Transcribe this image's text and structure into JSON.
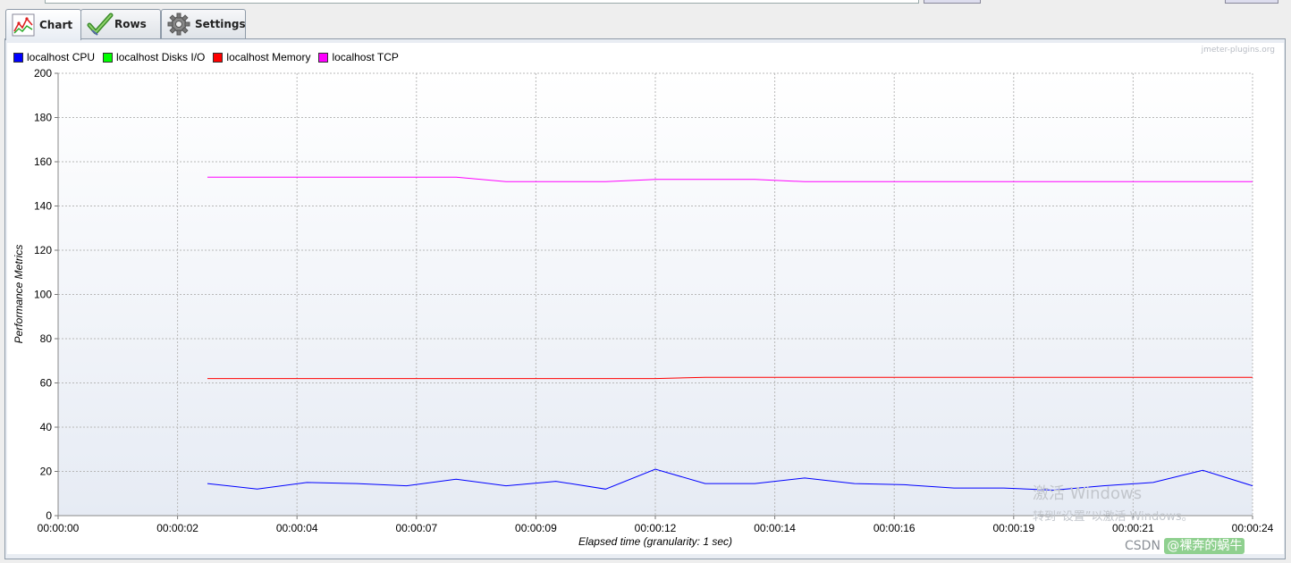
{
  "tabs": [
    {
      "label": "Chart",
      "icon": "line-chart-icon",
      "active": true
    },
    {
      "label": "Rows",
      "icon": "checkmark-icon",
      "active": false
    },
    {
      "label": "Settings",
      "icon": "gear-icon",
      "active": false
    }
  ],
  "watermark_site": "jmeter-plugins.org",
  "windows_activation": {
    "line1": "激活 Windows",
    "line2": "转到“设置”以激活 Windows。"
  },
  "csdn_watermark": {
    "prefix": "CSDN ",
    "author": "@裸奔的蜗牛"
  },
  "chart_data": {
    "type": "line",
    "xlabel": "Elapsed time (granularity: 1 sec)",
    "ylabel": "Performance Metrics",
    "ylim": [
      0,
      200
    ],
    "yticks": [
      0,
      20,
      40,
      60,
      80,
      100,
      120,
      140,
      160,
      180,
      200
    ],
    "xlim": [
      0,
      24
    ],
    "xticks": [
      {
        "value": 0,
        "label": "00:00:00"
      },
      {
        "value": 2.4,
        "label": "00:00:02"
      },
      {
        "value": 4.8,
        "label": "00:00:04"
      },
      {
        "value": 7.2,
        "label": "00:00:07"
      },
      {
        "value": 9.6,
        "label": "00:00:09"
      },
      {
        "value": 12,
        "label": "00:00:12"
      },
      {
        "value": 14.4,
        "label": "00:00:14"
      },
      {
        "value": 16.8,
        "label": "00:00:16"
      },
      {
        "value": 19.2,
        "label": "00:00:19"
      },
      {
        "value": 21.6,
        "label": "00:00:21"
      },
      {
        "value": 24,
        "label": "00:00:24"
      }
    ],
    "grid": true,
    "legend_position": "top-left",
    "x": [
      3,
      4,
      5,
      6,
      7,
      8,
      9,
      10,
      11,
      12,
      13,
      14,
      15,
      16,
      17,
      18,
      19,
      20,
      21,
      22,
      23,
      24
    ],
    "series": [
      {
        "name": "localhost CPU",
        "color": "#0000ff",
        "values": [
          14.5,
          12,
          15,
          14.5,
          13.5,
          16.5,
          13.5,
          15.5,
          12,
          21,
          14.5,
          14.5,
          17,
          14.5,
          14,
          12.5,
          12.5,
          11.5,
          13.5,
          15,
          20.5,
          13.5
        ]
      },
      {
        "name": "localhost Disks I/O",
        "color": "#00ff00",
        "values": [
          0,
          0,
          0,
          0,
          0,
          0,
          0,
          0,
          0,
          0,
          0,
          0,
          0,
          0,
          0,
          0,
          0,
          0,
          0,
          0,
          0,
          0
        ]
      },
      {
        "name": "localhost Memory",
        "color": "#ff0000",
        "values": [
          62,
          62,
          62,
          62,
          62,
          62,
          62,
          62,
          62,
          62,
          62.5,
          62.5,
          62.5,
          62.5,
          62.5,
          62.5,
          62.5,
          62.5,
          62.5,
          62.5,
          62.5,
          62.5
        ]
      },
      {
        "name": "localhost TCP",
        "color": "#ff00ff",
        "values": [
          153,
          153,
          153,
          153,
          153,
          153,
          151,
          151,
          151,
          152,
          152,
          152,
          151,
          151,
          151,
          151,
          151,
          151,
          151,
          151,
          151,
          151
        ]
      }
    ]
  }
}
